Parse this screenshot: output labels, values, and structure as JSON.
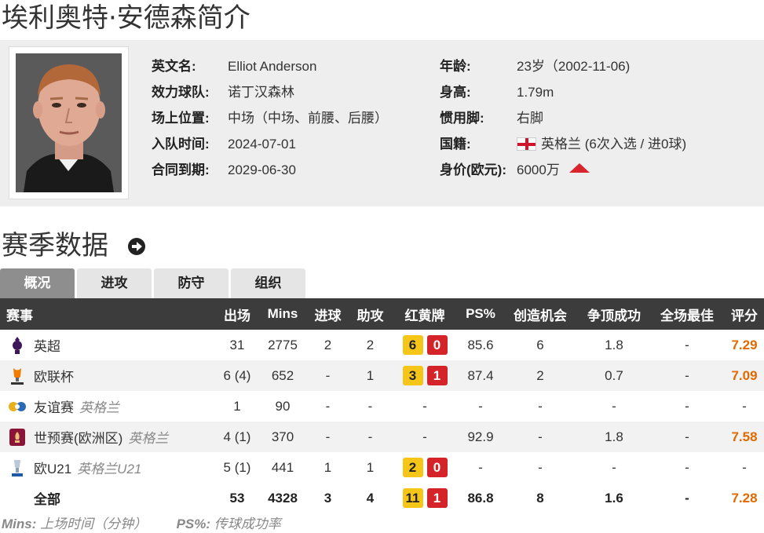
{
  "page_title": "埃利奥特·安德森简介",
  "profile": {
    "rows_left": [
      {
        "label": "英文名:",
        "value": "Elliot Anderson"
      },
      {
        "label": "效力球队:",
        "value": "诺丁汉森林"
      },
      {
        "label": "场上位置:",
        "value": "中场（中场、前腰、后腰）"
      },
      {
        "label": "入队时间:",
        "value": "2024-07-01"
      },
      {
        "label": "合同到期:",
        "value": "2029-06-30"
      }
    ],
    "rows_right": [
      {
        "label": "年龄:",
        "value": "23岁（2002-11-06)"
      },
      {
        "label": "身高:",
        "value": "1.79m"
      },
      {
        "label": "惯用脚:",
        "value": "右脚"
      },
      {
        "label": "国籍:",
        "value": "英格兰 (6次入选 / 进0球)"
      },
      {
        "label": "身价(欧元):",
        "value": "6000万"
      }
    ],
    "trend_color": "#d9232d"
  },
  "section_title": "赛季数据",
  "tabs": [
    "概况",
    "进攻",
    "防守",
    "组织"
  ],
  "active_tab": 0,
  "table": {
    "headers": [
      "赛事",
      "出场",
      "Mins",
      "进球",
      "助攻",
      "红黄牌",
      "PS%",
      "创造机会",
      "争顶成功",
      "全场最佳",
      "评分"
    ],
    "rows": [
      {
        "icon": "premier-league-icon",
        "name": "英超",
        "sub": "",
        "apps": "31",
        "mins": "2775",
        "goals": "2",
        "assists": "2",
        "yellow": "6",
        "red": "0",
        "ps": "85.6",
        "chances": "6",
        "aerials": "1.8",
        "motm": "-",
        "rating": "7.29"
      },
      {
        "icon": "europa-league-icon",
        "name": "欧联杯",
        "sub": "",
        "apps": "6 (4)",
        "mins": "652",
        "goals": "-",
        "assists": "1",
        "yellow": "3",
        "red": "1",
        "ps": "87.4",
        "chances": "2",
        "aerials": "0.7",
        "motm": "-",
        "rating": "7.09"
      },
      {
        "icon": "friendly-icon",
        "name": "友谊赛",
        "sub": "英格兰",
        "apps": "1",
        "mins": "90",
        "goals": "-",
        "assists": "-",
        "yellow": "",
        "red": "",
        "cards_text": "-",
        "ps": "-",
        "chances": "-",
        "aerials": "-",
        "motm": "-",
        "rating": "-"
      },
      {
        "icon": "wc-qualifier-icon",
        "name": "世预赛(欧洲区)",
        "sub": "英格兰",
        "apps": "4 (1)",
        "mins": "370",
        "goals": "-",
        "assists": "-",
        "yellow": "",
        "red": "",
        "cards_text": "-",
        "ps": "92.9",
        "chances": "-",
        "aerials": "1.8",
        "motm": "-",
        "rating": "7.58"
      },
      {
        "icon": "euro-u21-icon",
        "name": "欧U21",
        "sub": "英格兰U21",
        "apps": "5 (1)",
        "mins": "441",
        "goals": "1",
        "assists": "1",
        "yellow": "2",
        "red": "0",
        "ps": "-",
        "chances": "-",
        "aerials": "-",
        "motm": "-",
        "rating": "-"
      },
      {
        "icon": "",
        "name": "全部",
        "sub": "",
        "apps": "53",
        "mins": "4328",
        "goals": "3",
        "assists": "4",
        "yellow": "11",
        "red": "1",
        "ps": "86.8",
        "chances": "8",
        "aerials": "1.6",
        "motm": "-",
        "rating": "7.28"
      }
    ]
  },
  "footer": {
    "mins_key": "Mins:",
    "mins_desc": "上场时间（分钟）",
    "ps_key": "PS%:",
    "ps_desc": "传球成功率"
  },
  "colors": {
    "yellow_card": "#f5c518",
    "red_card": "#d4242a",
    "rating": "#e06a00",
    "header_bg": "#3c3c3c"
  }
}
